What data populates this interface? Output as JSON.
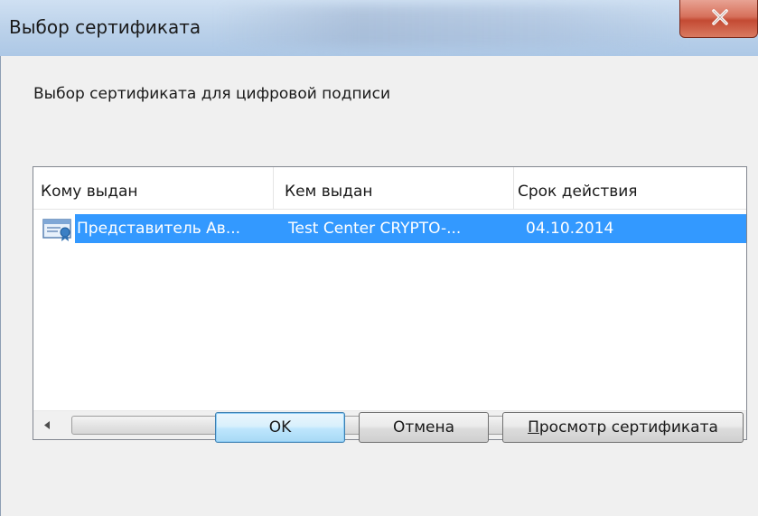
{
  "window": {
    "title": "Выбор сертификата",
    "instruction": "Выбор сертификата для цифровой подписи"
  },
  "columns": [
    "Кому выдан",
    "Кем выдан",
    "Срок действия"
  ],
  "rows": [
    {
      "issued_to": "Представитель Ав...",
      "issued_by": "Test Center CRYPTO-...",
      "expires": "04.10.2014",
      "selected": true,
      "icon": "certificate-icon"
    }
  ],
  "scrollbar": {
    "left_arrow": "◄",
    "right_arrow": "►",
    "grip": "III"
  },
  "buttons": {
    "ok_label": "OK",
    "cancel_label": "Отмена",
    "view_hotkey": "П",
    "view_rest": "росмотр сертификата"
  },
  "colors": {
    "selection": "#3399ff",
    "close_button": "#c8503a"
  }
}
